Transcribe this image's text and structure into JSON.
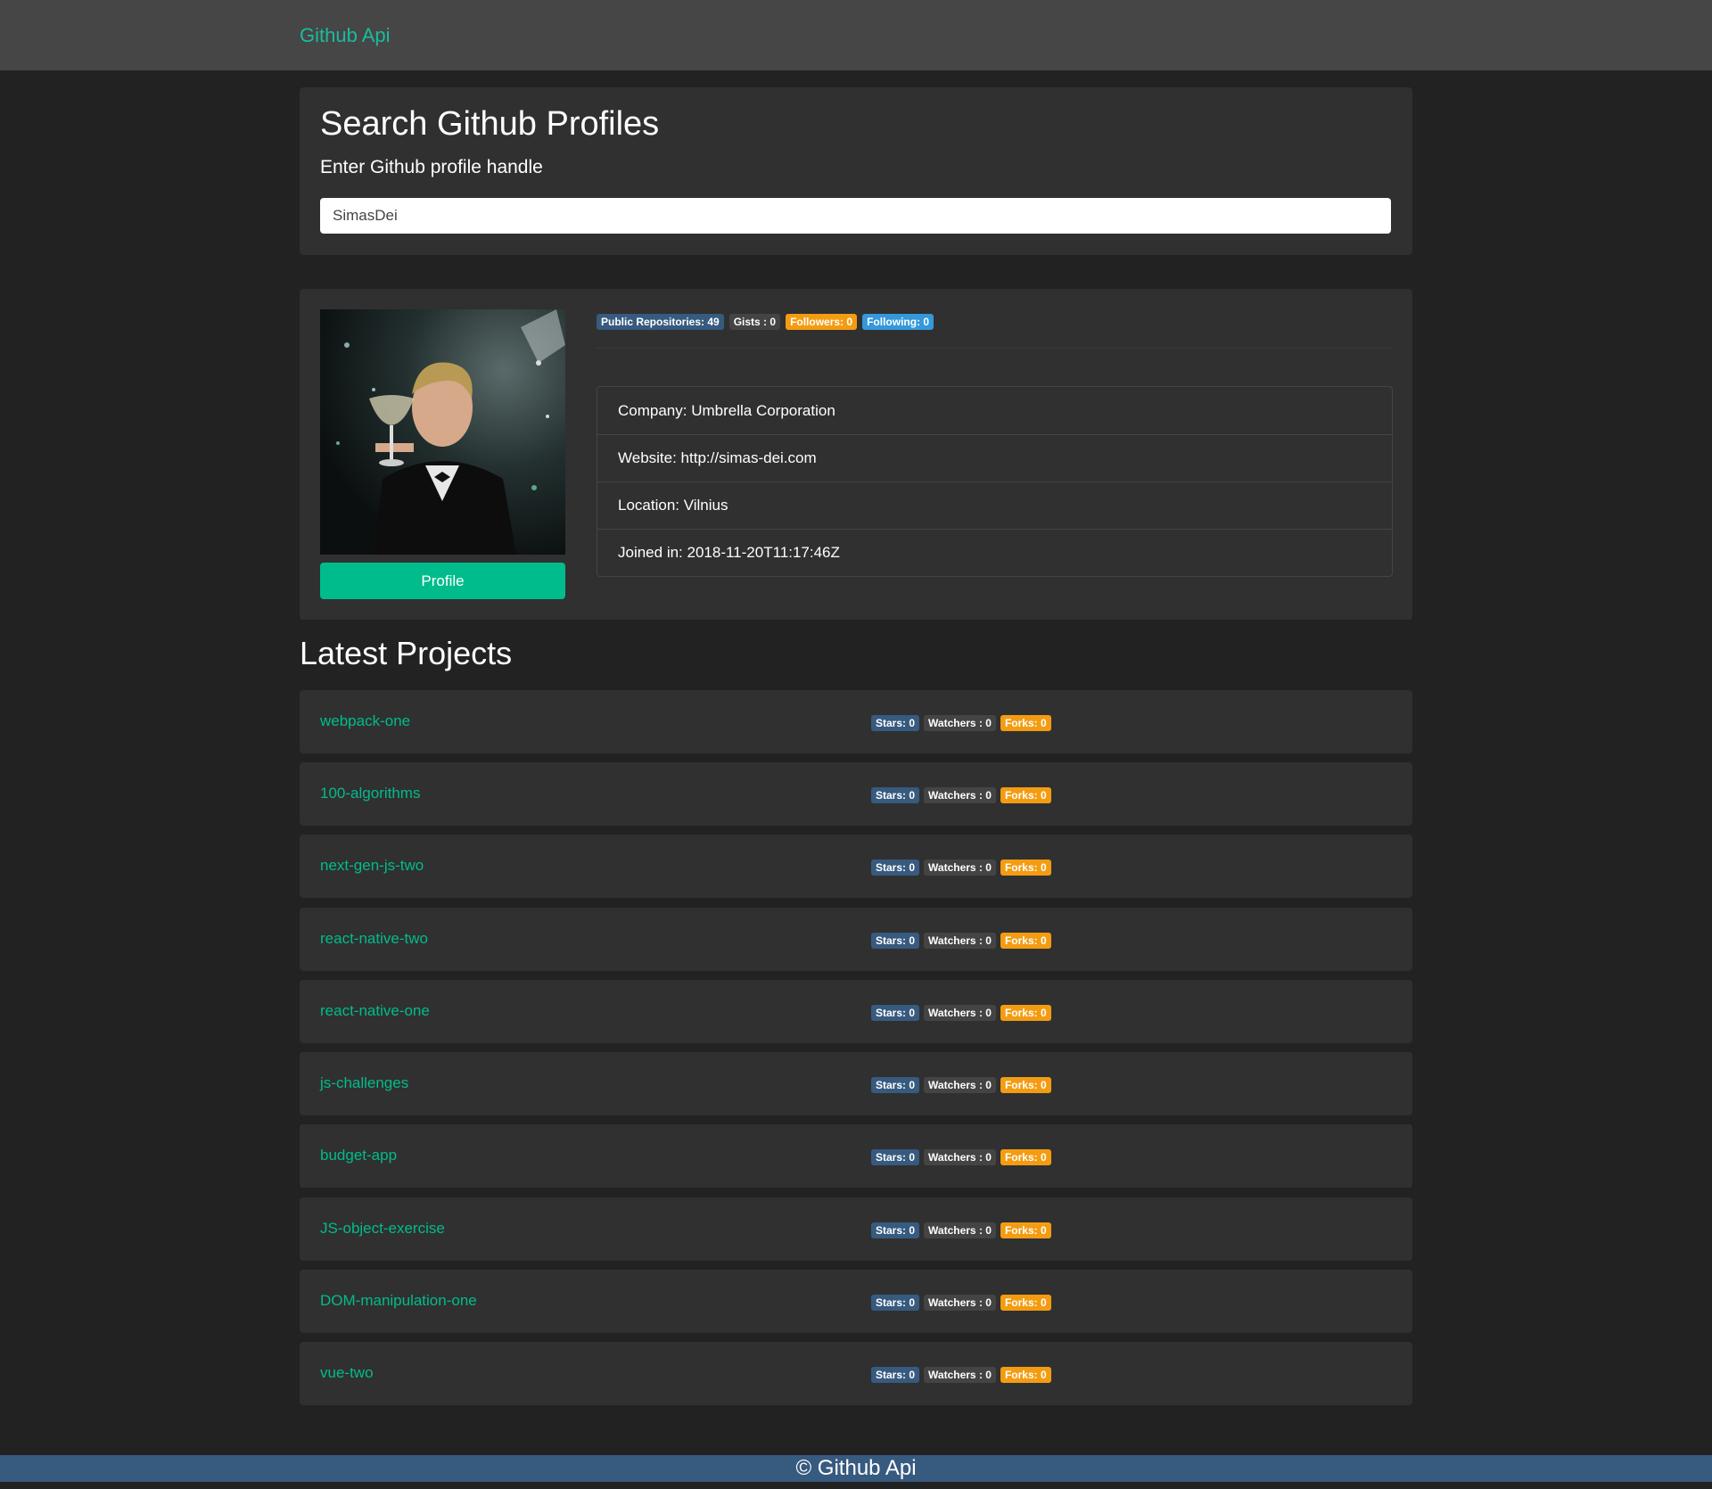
{
  "navbar": {
    "brand": "Github Api"
  },
  "search": {
    "title": "Search Github Profiles",
    "subtitle": "Enter Github profile handle",
    "value": "SimasDei"
  },
  "profile": {
    "button_label": "Profile",
    "badges": [
      "Public Repositories: 49",
      "Gists : 0",
      "Followers: 0",
      "Following: 0"
    ],
    "info": [
      "Company: Umbrella Corporation",
      "Website: http://simas-dei.com",
      "Location: Vilnius",
      "Joined in: 2018-11-20T11:17:46Z"
    ]
  },
  "projects": {
    "title": "Latest Projects",
    "repos": [
      {
        "name": "webpack-one",
        "stars": "Stars: 0",
        "watchers": "Watchers : 0",
        "forks": "Forks: 0"
      },
      {
        "name": "100-algorithms",
        "stars": "Stars: 0",
        "watchers": "Watchers : 0",
        "forks": "Forks: 0"
      },
      {
        "name": "next-gen-js-two",
        "stars": "Stars: 0",
        "watchers": "Watchers : 0",
        "forks": "Forks: 0"
      },
      {
        "name": "react-native-two",
        "stars": "Stars: 0",
        "watchers": "Watchers : 0",
        "forks": "Forks: 0"
      },
      {
        "name": "react-native-one",
        "stars": "Stars: 0",
        "watchers": "Watchers : 0",
        "forks": "Forks: 0"
      },
      {
        "name": "js-challenges",
        "stars": "Stars: 0",
        "watchers": "Watchers : 0",
        "forks": "Forks: 0"
      },
      {
        "name": "budget-app",
        "stars": "Stars: 0",
        "watchers": "Watchers : 0",
        "forks": "Forks: 0"
      },
      {
        "name": "JS-object-exercise",
        "stars": "Stars: 0",
        "watchers": "Watchers : 0",
        "forks": "Forks: 0"
      },
      {
        "name": "DOM-manipulation-one",
        "stars": "Stars: 0",
        "watchers": "Watchers : 0",
        "forks": "Forks: 0"
      },
      {
        "name": "vue-two",
        "stars": "Stars: 0",
        "watchers": "Watchers : 0",
        "forks": "Forks: 0"
      }
    ]
  },
  "footer": {
    "text": "© Github Api"
  },
  "colors": {
    "accent": "#00bc8c",
    "primary": "#375a7f",
    "warning": "#f39c12",
    "info": "#3498db",
    "secondary": "#444444",
    "background": "#222222",
    "panel": "#303030"
  }
}
